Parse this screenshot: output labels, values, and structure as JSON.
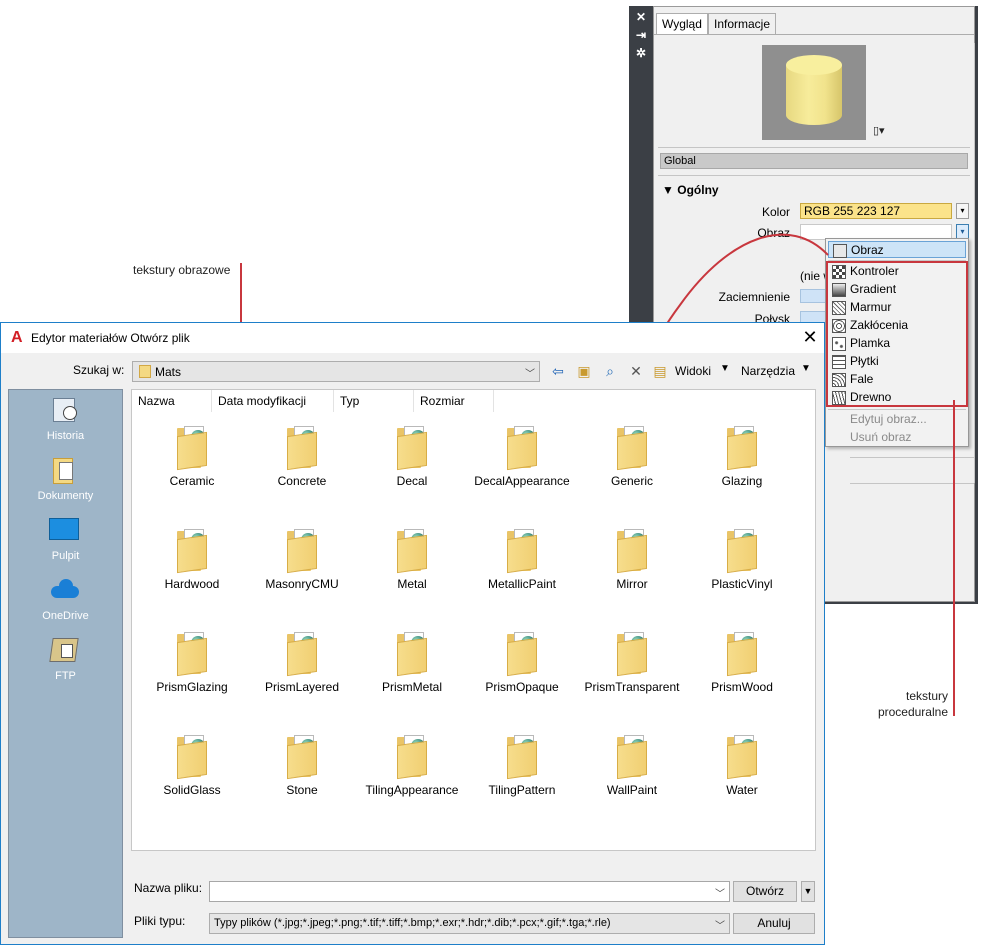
{
  "palette": {
    "tabs": [
      "Wygląd",
      "Informacje"
    ],
    "strip_icons": [
      "close-icon",
      "pin-icon",
      "settings-icon"
    ],
    "global_label": "Global",
    "section_title": "Ogólny",
    "kolor_label": "Kolor",
    "kolor_value": "RGB 255 223 127",
    "obraz_label": "Obraz",
    "nie_text": "(nie w",
    "zaciemnienie_label": "Zaciemnienie",
    "polysk_label": "Połysk"
  },
  "menu": {
    "selected": "Obraz",
    "items": [
      "Kontroler",
      "Gradient",
      "Marmur",
      "Zakłócenia",
      "Plamka",
      "Płytki",
      "Fale",
      "Drewno"
    ],
    "disabled": [
      "Edytuj obraz...",
      "Usuń obraz"
    ]
  },
  "annotations": {
    "image_textures": "tekstury obrazowe",
    "procedural_1": "tekstury",
    "procedural_2": "proceduralne"
  },
  "dialog": {
    "title": "Edytor materiałów Otwórz plik",
    "lookin_label": "Szukaj w:",
    "lookin_value": "Mats",
    "views_label": "Widoki",
    "tools_label": "Narzędzia",
    "places": [
      "Historia",
      "Dokumenty",
      "Pulpit",
      "OneDrive",
      "FTP"
    ],
    "columns": [
      "Nazwa",
      "Data modyfikacji",
      "Typ",
      "Rozmiar"
    ],
    "files": [
      "Ceramic",
      "Concrete",
      "Decal",
      "DecalAppearance",
      "Generic",
      "Glazing",
      "Hardwood",
      "MasonryCMU",
      "Metal",
      "MetallicPaint",
      "Mirror",
      "PlasticVinyl",
      "PrismGlazing",
      "PrismLayered",
      "PrismMetal",
      "PrismOpaque",
      "PrismTransparent",
      "PrismWood",
      "SolidGlass",
      "Stone",
      "TilingAppearance",
      "TilingPattern",
      "WallPaint",
      "Water"
    ],
    "filename_label": "Nazwa pliku:",
    "filename_value": "",
    "filetype_label": "Pliki typu:",
    "filetype_value": "Typy plików  (*.jpg;*.jpeg;*.png;*.tif;*.tiff;*.bmp;*.exr;*.hdr;*.dib;*.pcx;*.gif;*.tga;*.rle)",
    "open_label": "Otwórz",
    "cancel_label": "Anuluj"
  },
  "colors": {
    "accent_red": "#c8373e",
    "kolor_swatch": "#fbe38a",
    "places_bg": "#9eb5c8"
  }
}
